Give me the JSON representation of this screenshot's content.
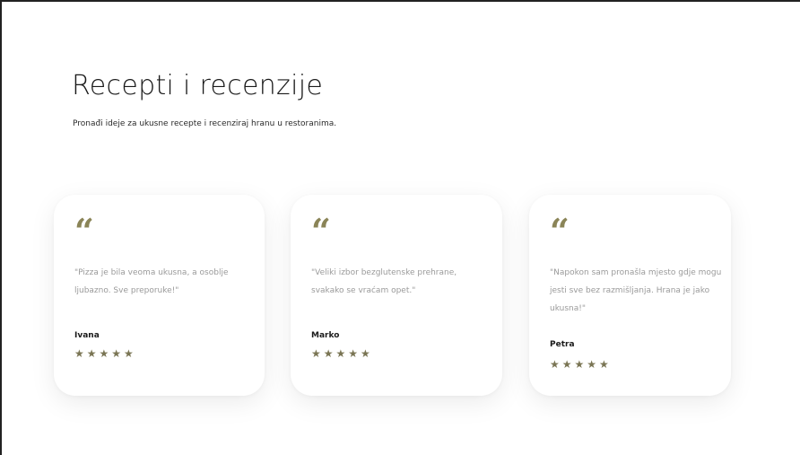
{
  "page": {
    "title": "Recepti i recenzije",
    "subtitle": "Pronađi ideje za ukusne recepte i recenziraj hranu u restoranima."
  },
  "reviews": [
    {
      "quote_mark": "“",
      "text": "\"Pizza je bila veoma ukusna, a osoblje ljubazno. Sve preporuke!\"",
      "author": "Ivana",
      "rating": 5,
      "stars": "★★★★★"
    },
    {
      "quote_mark": "“",
      "text": "\"Veliki izbor bezglutenske prehrane, svakako se vraćam opet.\"",
      "author": "Marko",
      "rating": 5,
      "stars": "★★★★★"
    },
    {
      "quote_mark": "“",
      "text": "\"Napokon sam pronašla mjesto gdje mogu jesti sve bez razmišljanja. Hrana je jako ukusna!\"",
      "author": "Petra",
      "rating": 5,
      "stars": "★★★★★"
    }
  ],
  "colors": {
    "accent": "#8a8457",
    "star": "#7a7554",
    "muted_text": "#9a9a9a"
  }
}
